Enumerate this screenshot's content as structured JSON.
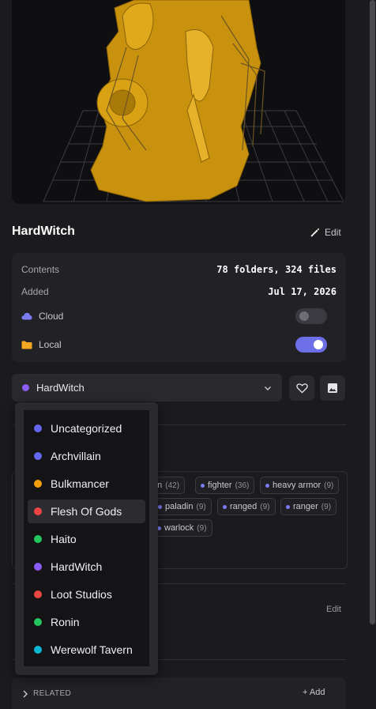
{
  "model": {
    "title": "HardWitch",
    "edit_label": "Edit"
  },
  "info": {
    "contents_label": "Contents",
    "contents_value": "78 folders, 324 files",
    "added_label": "Added",
    "added_value": "Jul 17, 2026",
    "cloud_label": "Cloud",
    "cloud_enabled": false,
    "local_label": "Local",
    "local_enabled": true
  },
  "collection": {
    "selected": "HardWitch",
    "selected_color": "#8b5cf6"
  },
  "dropdown": {
    "options": [
      {
        "label": "Uncategorized",
        "color": "#6366f1"
      },
      {
        "label": "Archvillain",
        "color": "#6366f1"
      },
      {
        "label": "Bulkmancer",
        "color": "#f59e0b"
      },
      {
        "label": "Flesh Of Gods",
        "color": "#ef4444"
      },
      {
        "label": "Haito",
        "color": "#22c55e"
      },
      {
        "label": "HardWitch",
        "color": "#8b5cf6"
      },
      {
        "label": "Loot Studios",
        "color": "#ef4444"
      },
      {
        "label": "Ronin",
        "color": "#22c55e"
      },
      {
        "label": "Werewolf Tavern",
        "color": "#06b6d4"
      }
    ],
    "highlighted": "Flesh Of Gods"
  },
  "tags": {
    "row1": [
      {
        "name": "on",
        "count": "(42)"
      },
      {
        "name": "fighter",
        "count": "(36)"
      },
      {
        "name": "heavy armor",
        "count": "(9)"
      }
    ],
    "row2": [
      {
        "name": "paladin",
        "count": "(9)"
      },
      {
        "name": "ranged",
        "count": "(9)"
      },
      {
        "name": "ranger",
        "count": "(9)"
      }
    ],
    "row3": [
      {
        "name": "warlock",
        "count": "(9)"
      }
    ]
  },
  "notes": {
    "edit_label": "Edit"
  },
  "related": {
    "label": "RELATED",
    "add_label": "+ Add"
  },
  "colors": {
    "accent": "#6d6fe8",
    "folder": "#f5a623",
    "cloud": "#7b7cf2",
    "model_gold": "#d4a017"
  }
}
